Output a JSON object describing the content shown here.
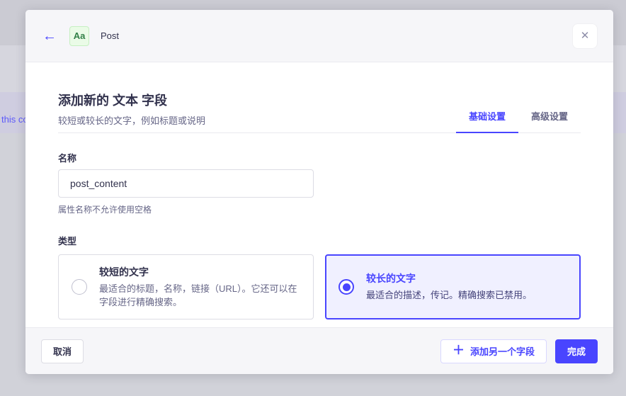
{
  "backdrop": {
    "partial_text": "this co"
  },
  "modal": {
    "header": {
      "back_icon": "←",
      "badge_label": "Aa",
      "title": "Post",
      "close_icon": "✕"
    },
    "title": "添加新的 文本 字段",
    "subtitle": "较短或较长的文字，例如标题或说明",
    "tabs": [
      {
        "label": "基础设置",
        "active": true
      },
      {
        "label": "高级设置",
        "active": false
      }
    ],
    "form": {
      "name_label": "名称",
      "name_value": "post_content",
      "name_hint": "属性名称不允许使用空格",
      "type_label": "类型",
      "options": [
        {
          "title": "较短的文字",
          "description": "最适合的标题，名称，链接（URL）。它还可以在字段进行精确搜索。",
          "selected": false
        },
        {
          "title": "较长的文字",
          "description": "最适合的描述，传记。精确搜索已禁用。",
          "selected": true
        }
      ]
    },
    "footer": {
      "cancel": "取消",
      "plus_icon": "＋",
      "add_another": "添加另一个字段",
      "finish": "完成"
    }
  },
  "colors": {
    "primary": "#4945ff",
    "primary_bg": "#f0f0ff",
    "success_text": "#328048",
    "success_bg": "#eafbe7",
    "neutral_text": "#32324d",
    "muted_text": "#666687",
    "border": "#dcdce4"
  }
}
